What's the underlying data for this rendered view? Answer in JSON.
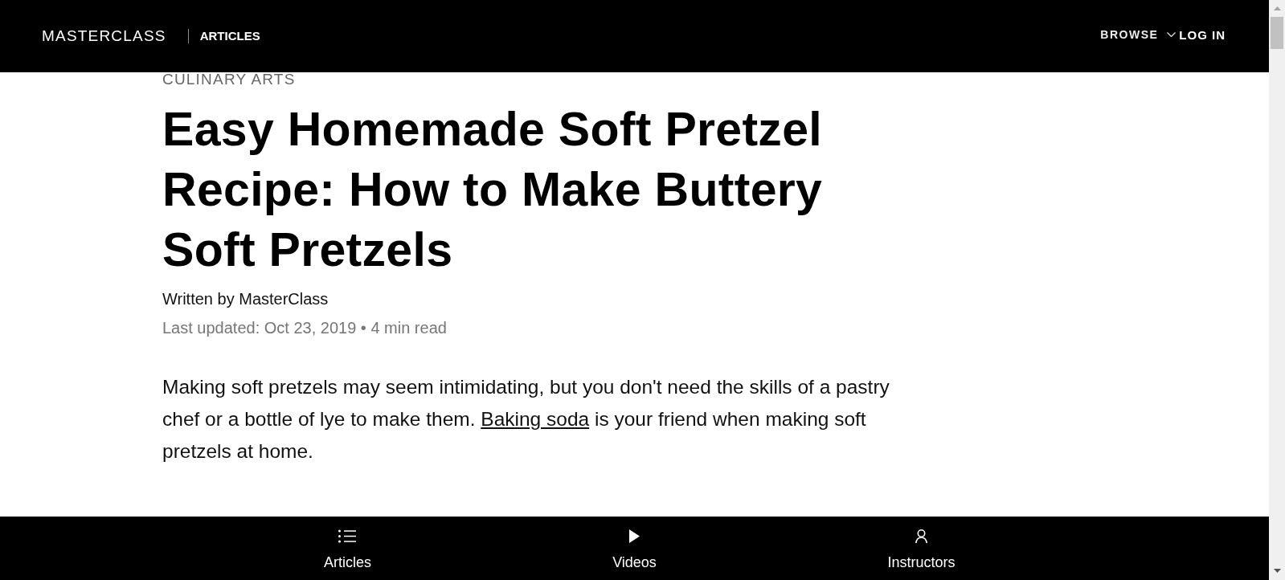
{
  "header": {
    "logo": "MASTERCLASS",
    "section": "ARTICLES",
    "nav": [
      {
        "label": "BROWSE",
        "kind": "menu"
      },
      {
        "label": "LOG IN",
        "kind": "link"
      }
    ]
  },
  "article": {
    "category": "CULINARY ARTS",
    "title": "Easy Homemade Soft Pretzel Recipe: How to Make Buttery Soft Pretzels",
    "byline": "Written by MasterClass",
    "meta": "Last updated: Oct 23, 2019 • 4 min read",
    "paragraph": [
      {
        "kind": "text",
        "text": "Making soft pretzels may seem intimidating, but you don't need the skills of a pastry chef or a bottle of lye to make them. "
      },
      {
        "kind": "link",
        "text": "Baking soda"
      },
      {
        "kind": "text",
        "text": " is your friend when making soft pretzels at home."
      }
    ]
  },
  "bottom_nav": [
    {
      "label": "Articles",
      "kind": "list"
    },
    {
      "label": "Videos",
      "kind": "play"
    },
    {
      "label": "Instructors",
      "kind": "person"
    }
  ]
}
